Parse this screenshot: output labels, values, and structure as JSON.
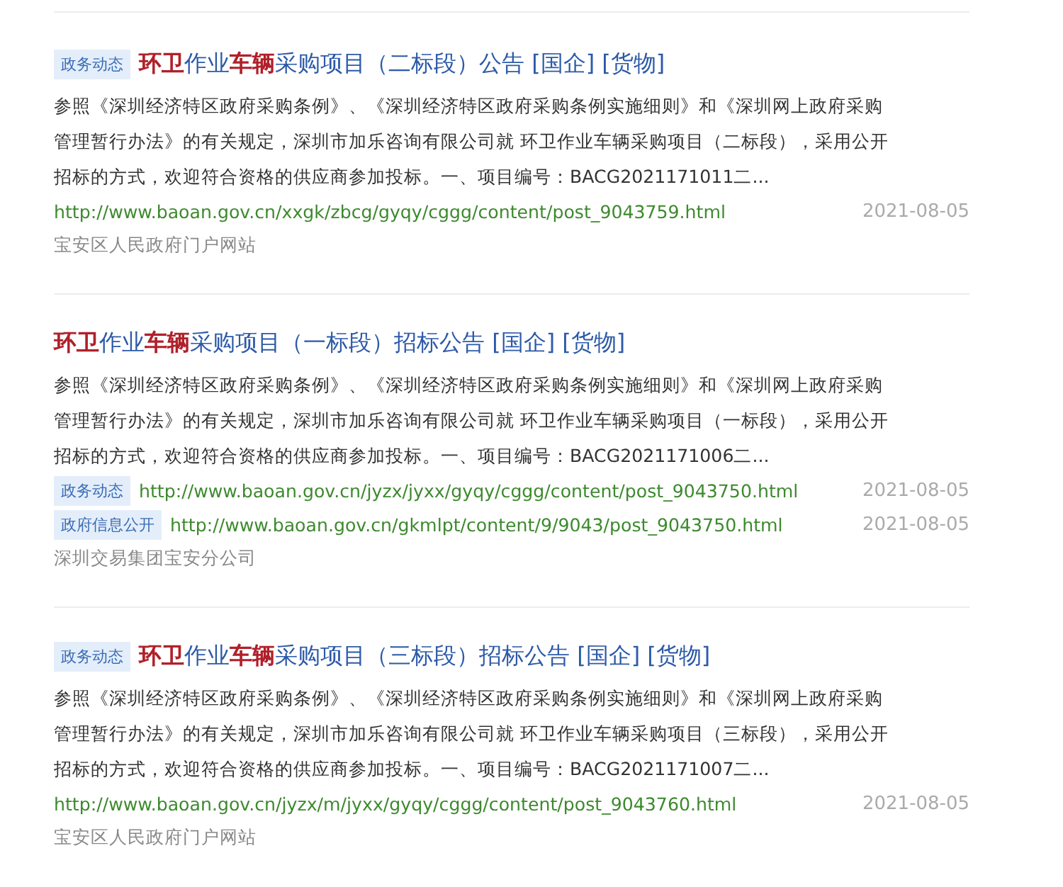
{
  "results": [
    {
      "tag": "政务动态",
      "title": "**环卫**作业**车辆**采购项目（二标段）公告 [国企] [货物]",
      "snippet": [
        "参照《深圳经济特区政府采购条例》、《深圳经济特区政府采购条例实施细则》和《深圳网上政府采购",
        "管理暂行办法》的有关规定，深圳市加乐咨询有限公司就  环卫作业车辆采购项目（二标段），采用公开",
        "招标的方式，欢迎符合资格的供应商参加投标。一、项目编号：BACG2021171011二..."
      ],
      "links": [
        {
          "url": "http://www.baoan.gov.cn/xxgk/zbcg/gyqy/cggg/content/post_9043759.html",
          "date": "2021-08-05"
        }
      ],
      "source": "宝安区人民政府门户网站"
    },
    {
      "title": "**环卫**作业**车辆**采购项目（一标段）招标公告 [国企] [货物]",
      "snippet": [
        "参照《深圳经济特区政府采购条例》、《深圳经济特区政府采购条例实施细则》和《深圳网上政府采购",
        "管理暂行办法》的有关规定，深圳市加乐咨询有限公司就  环卫作业车辆采购项目（一标段），采用公开",
        "招标的方式，欢迎符合资格的供应商参加投标。一、项目编号：BACG2021171006二..."
      ],
      "links": [
        {
          "tag": "政务动态",
          "url": "http://www.baoan.gov.cn/jyzx/jyxx/gyqy/cggg/content/post_9043750.html",
          "date": "2021-08-05"
        },
        {
          "tag": "政府信息公开",
          "url": "http://www.baoan.gov.cn/gkmlpt/content/9/9043/post_9043750.html",
          "date": "2021-08-05"
        }
      ],
      "source": "深圳交易集团宝安分公司"
    },
    {
      "tag": "政务动态",
      "title": "**环卫**作业**车辆**采购项目（三标段）招标公告 [国企] [货物]",
      "snippet": [
        "参照《深圳经济特区政府采购条例》、《深圳经济特区政府采购条例实施细则》和《深圳网上政府采购",
        "管理暂行办法》的有关规定，深圳市加乐咨询有限公司就  环卫作业车辆采购项目（三标段），采用公开",
        "招标的方式，欢迎符合资格的供应商参加投标。一、项目编号：BACG2021171007二..."
      ],
      "links": [
        {
          "url": "http://www.baoan.gov.cn/jyzx/m/jyxx/gyqy/cggg/content/post_9043760.html",
          "date": "2021-08-05"
        }
      ],
      "source": "宝安区人民政府门户网站"
    }
  ]
}
